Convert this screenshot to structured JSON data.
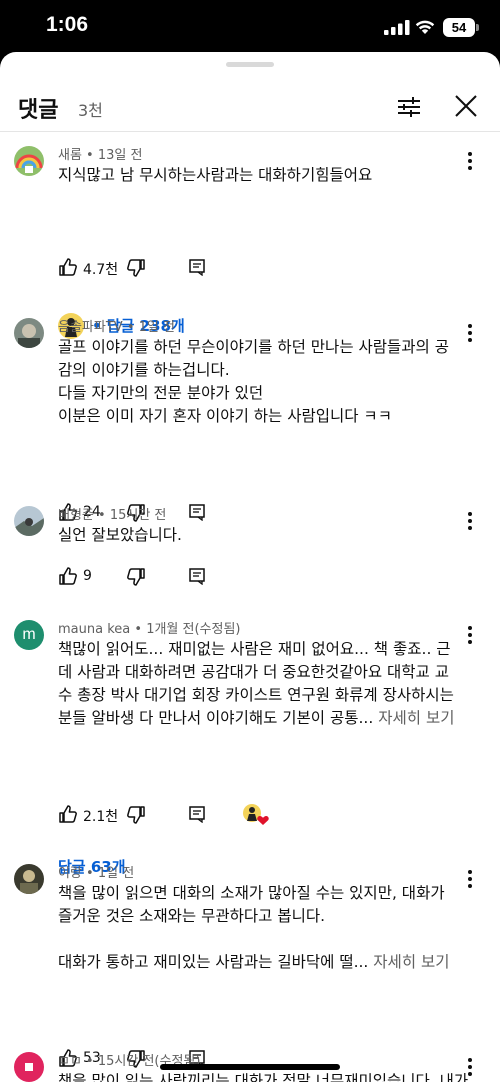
{
  "status_bar": {
    "time": "1:06",
    "battery": "54"
  },
  "header": {
    "title": "댓글",
    "count": "3천"
  },
  "comments": [
    {
      "author": "새롬",
      "time": "13일 전",
      "lines": [
        "지식많고  남 무시하는사람과는 대화하기힘들어요"
      ],
      "likes": "4.7천",
      "replies_label": "• 답글 238개",
      "avatar_color": "#9bbf7a"
    },
    {
      "author": "음솔파파TV",
      "time": "1일 전",
      "lines": [
        "골프 이야기를 하던 무슨이야기를 하던 만나는 사람들과의 공",
        "감의 이야기를 하는겁니다.",
        "다들 자기만의 전문 분야가 있던",
        "이분은 이미 자기 혼자 이야기 하는 사람입니다 ㅋㅋ"
      ],
      "likes": "24",
      "avatar_color": "#6f7b75"
    },
    {
      "author": "배형준",
      "time": "15시간 전",
      "lines": [
        "실언 잘보았습니다."
      ],
      "likes": "9",
      "avatar_color": "#8fa3b1"
    },
    {
      "author": "mauna kea",
      "time": "1개월 전(수정됨)",
      "lines": [
        "책많이 읽어도... 재미없는 사람은 재미 없어요... 책 좋죠.. 근",
        "데 사람과 대화하려면 공감대가 더 중요한것같아요 대학교 교",
        "수 총장 박사 대기업 회장 카이스트 연구원  화류계 장사하시는",
        "분들 알바생 다 만나서 이야기해도 기본이 공통..."
      ],
      "read_more": "자세히 보기",
      "likes": "2.1천",
      "replies_label": "답글 63개",
      "avatar_letter": "m",
      "avatar_color": "#1e8e6e"
    },
    {
      "author": "이랑",
      "time": "1일 전",
      "lines": [
        "책을 많이 읽으면 대화의 소재가 많아질 수는 있지만, 대화가",
        "즐거운 것은 소재와는 무관하다고 봅니다.",
        "",
        "대화가 통하고 재미있는 사람과는 길바닥에 떨..."
      ],
      "read_more": "자세히 보기",
      "likes": "53",
      "avatar_color": "#3a3a2e"
    },
    {
      "author": "ㅁㅁ",
      "time": "15시간 전(수정됨)",
      "lines": [
        "책을 많이 읽는 사람끼리는 대화가 정말 너무재미있습니다. 내가"
      ],
      "avatar_color": "#e0245e"
    }
  ]
}
